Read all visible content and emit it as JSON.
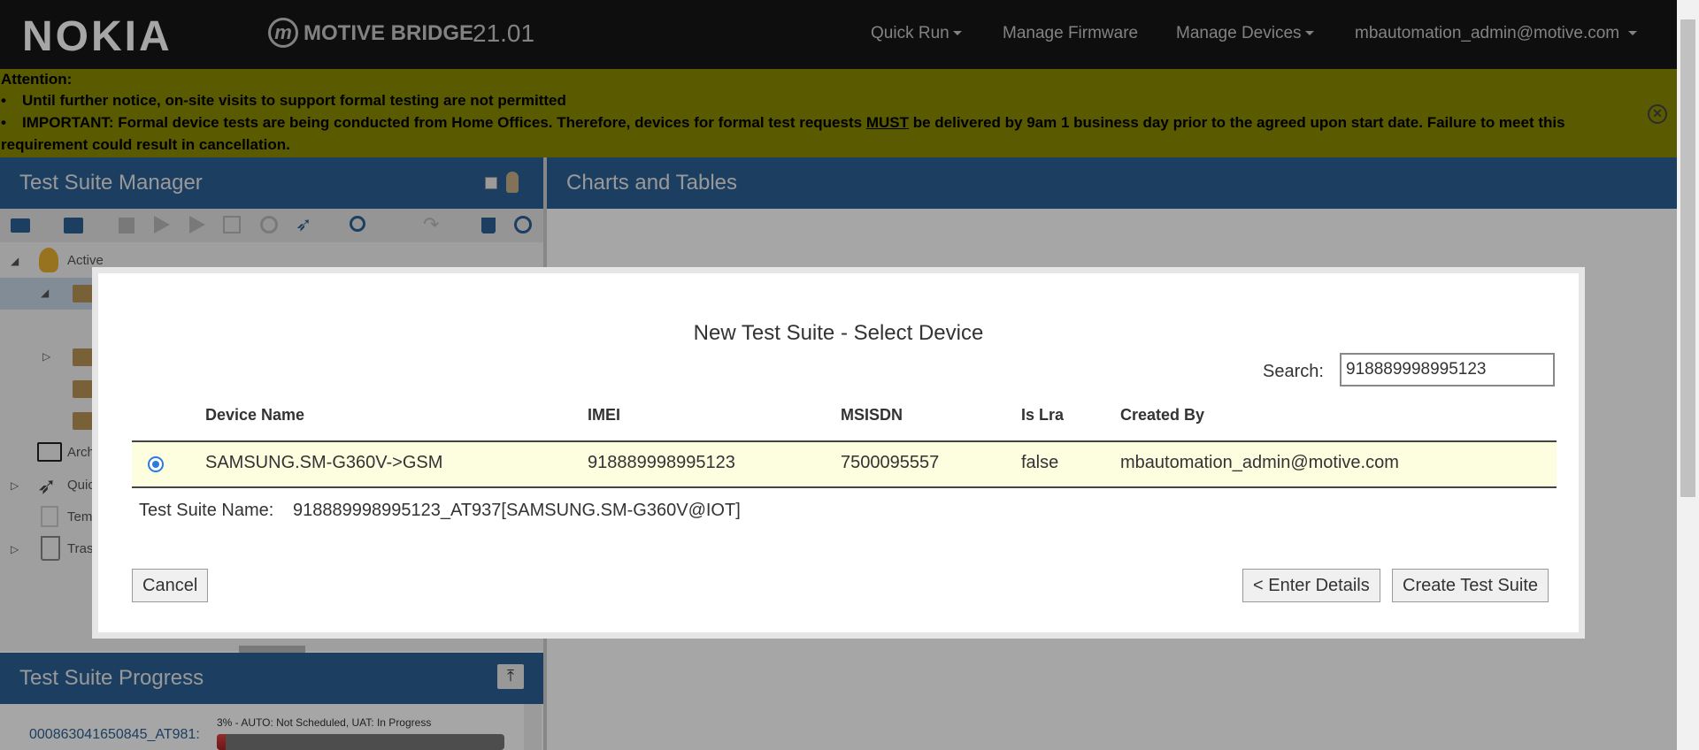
{
  "header": {
    "brand": "NOKIA",
    "product_mark": "m",
    "product": "MOTIVE BRIDGE",
    "version": "21.01",
    "nav": {
      "quick_run": "Quick Run",
      "manage_firmware": "Manage Firmware",
      "manage_devices": "Manage Devices",
      "user": "mbautomation_admin@motive.com"
    }
  },
  "banner": {
    "title": "Attention:",
    "bullet": "•",
    "line1": "Until further notice, on-site visits to support formal testing are not permitted",
    "line2_pre": "IMPORTANT: Formal device tests are being conducted from Home Offices. Therefore, devices for formal test requests ",
    "line2_emph": "MUST",
    "line2_post": " be delivered by 9am 1 business day prior to the agreed upon start date. Failure to meet this",
    "line3": "requirement could result in cancellation.",
    "close_glyph": "✕",
    "color": "#8a8a00"
  },
  "left_panel": {
    "title": "Test Suite Manager",
    "tree": {
      "active": "Active",
      "archive": "Arch",
      "quick": "Quic",
      "templates": "Tem",
      "trash": "Tras"
    }
  },
  "right_panel": {
    "title": "Charts and Tables"
  },
  "progress_panel": {
    "title": "Test Suite Progress",
    "item_name": "000863041650845_AT981:",
    "item_status": "3% - AUTO: Not Scheduled, UAT: In Progress",
    "item_percent": 3
  },
  "modal": {
    "title": "New Test Suite - Select Device",
    "search_label": "Search:",
    "search_value": "918889998995123",
    "columns": {
      "device_name": "Device Name",
      "imei": "IMEI",
      "msisdn": "MSISDN",
      "is_lra": "Is Lra",
      "created_by": "Created By"
    },
    "rows": [
      {
        "device_name": "SAMSUNG.SM-G360V->GSM",
        "imei": "918889998995123",
        "msisdn": "7500095557",
        "is_lra": "false",
        "created_by": "mbautomation_admin@motive.com"
      }
    ],
    "test_suite_name_label": "Test Suite Name:",
    "test_suite_name_value": "918889998995123_AT937[SAMSUNG.SM-G360V@IOT]",
    "cancel_label": "Cancel",
    "back_label": "< Enter Details",
    "create_label": "Create Test Suite"
  },
  "colors": {
    "nav_bg": "#161616",
    "panel_header": "#2b6196",
    "selected_row": "#fdfde0",
    "radio": "#2a7ae2"
  }
}
